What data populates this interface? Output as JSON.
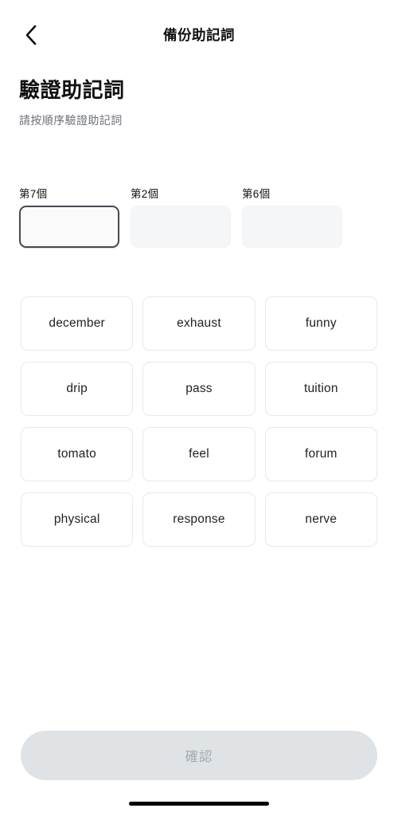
{
  "header": {
    "back_icon": "chevron-left-icon",
    "title": "備份助記詞"
  },
  "content": {
    "title": "驗證助記詞",
    "subtitle": "請按順序驗證助記詞"
  },
  "slots": [
    {
      "label": "第7個",
      "value": "",
      "active": true
    },
    {
      "label": "第2個",
      "value": "",
      "active": false
    },
    {
      "label": "第6個",
      "value": "",
      "active": false
    }
  ],
  "word_grid": {
    "columns": 3,
    "words": [
      "december",
      "exhaust",
      "funny",
      "drip",
      "pass",
      "tuition",
      "tomato",
      "feel",
      "forum",
      "physical",
      "response",
      "nerve"
    ]
  },
  "footer": {
    "confirm_label": "確認",
    "confirm_enabled": false
  },
  "colors": {
    "background": "#ffffff",
    "text_primary": "#111111",
    "text_secondary": "#6b6f76",
    "slot_fill": "#f5f6f8",
    "slot_active_border": "#454a4f",
    "tile_border": "#e6e8ec",
    "button_disabled_bg": "#dfe3e5",
    "button_disabled_text": "#a4abb0",
    "home_indicator": "#000000"
  }
}
